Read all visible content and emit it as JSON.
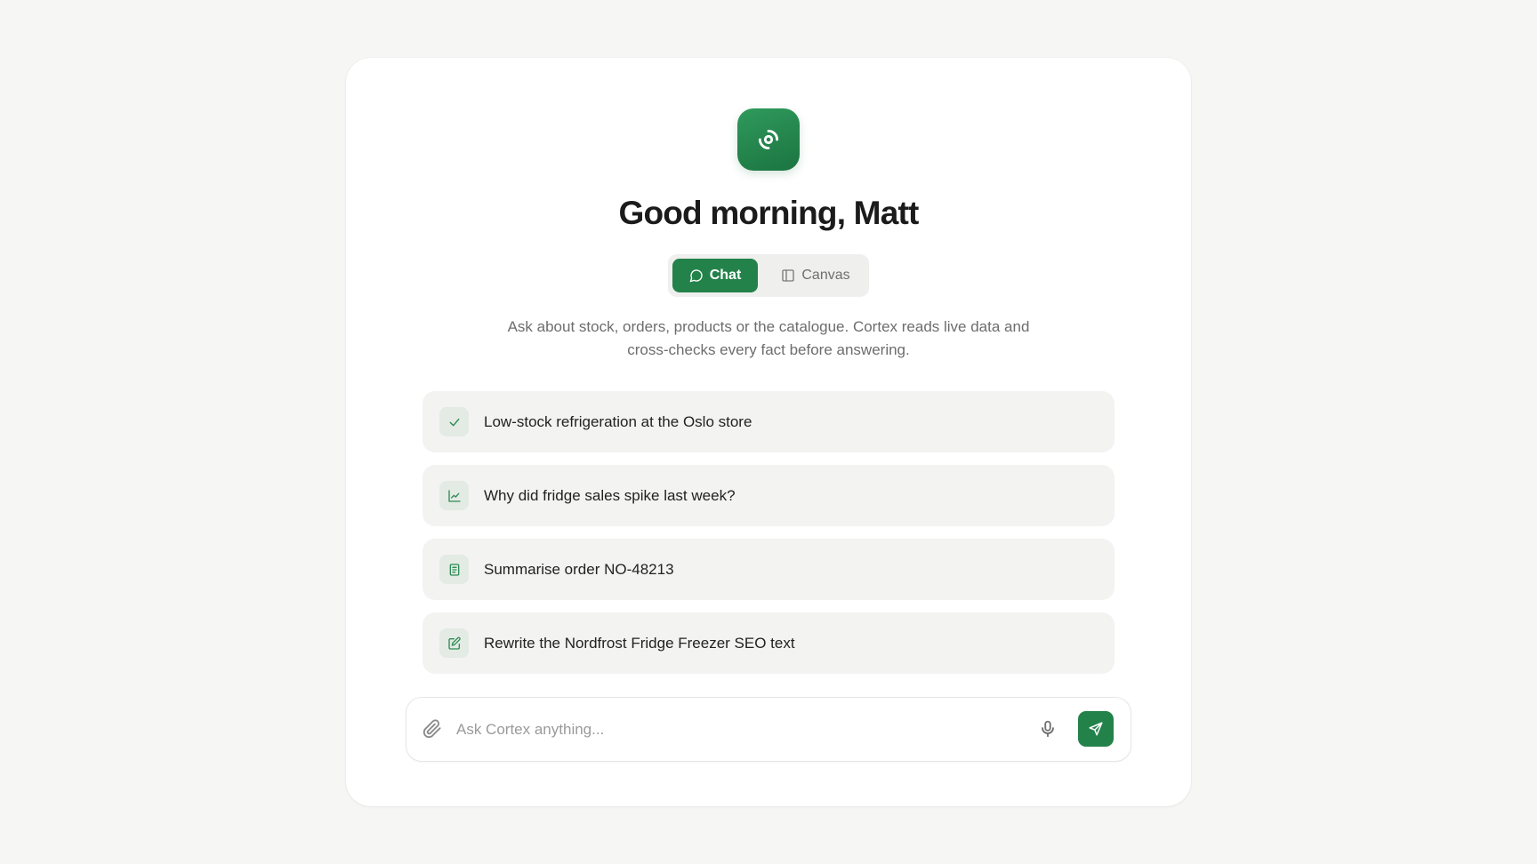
{
  "greeting": "Good morning, Matt",
  "mode_toggle": {
    "chat_label": "Chat",
    "canvas_label": "Canvas",
    "selected": "Chat"
  },
  "description": "Ask about stock, orders, products or the catalogue. Cortex reads live data and cross-checks every fact before answering.",
  "suggestions": [
    {
      "label": "Low-stock refrigeration at the Oslo store",
      "icon": "check-icon"
    },
    {
      "label": "Why did fridge sales spike last week?",
      "icon": "line-chart-icon"
    },
    {
      "label": "Summarise order NO-48213",
      "icon": "document-icon"
    },
    {
      "label": "Rewrite the Nordfrost Fridge Freezer SEO text",
      "icon": "edit-icon"
    }
  ],
  "composer": {
    "placeholder": "Ask Cortex anything...",
    "value": ""
  },
  "colors": {
    "accent": "#23824a",
    "page_background": "#f6f6f5",
    "card_background": "#ffffff",
    "suggestion_background": "#f3f3f2"
  }
}
